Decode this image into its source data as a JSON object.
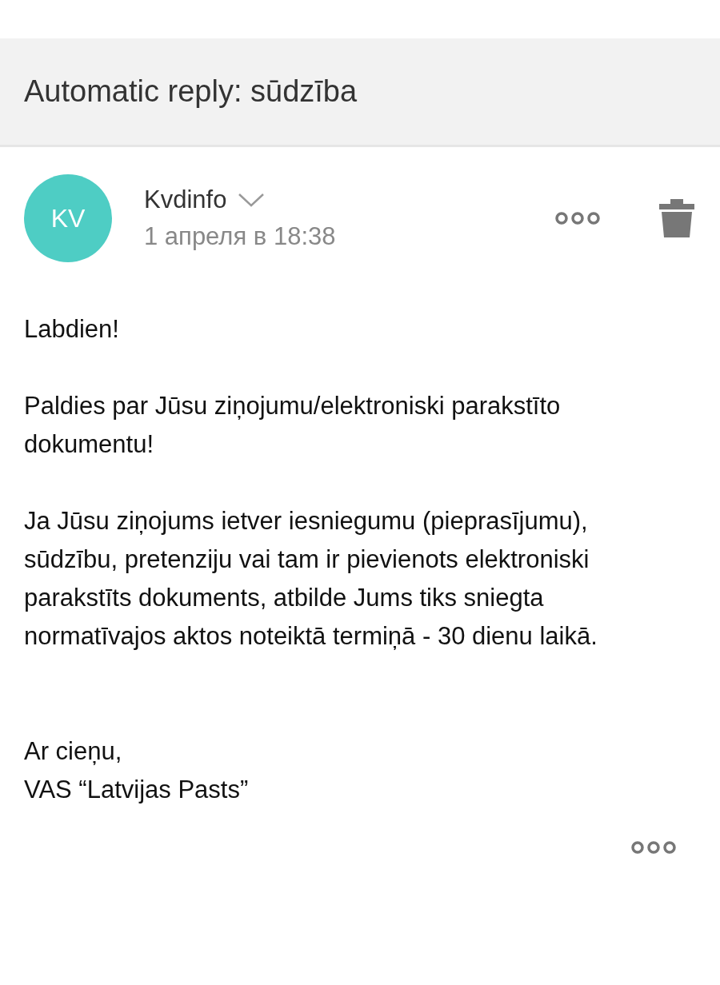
{
  "header": {
    "title": "Automatic reply: sūdzība"
  },
  "sender": {
    "initials": "KV",
    "color": "#4ecdc4",
    "name": "Kvdinfo",
    "date": "1 апреля в 18:38"
  },
  "body": {
    "paragraphs": [
      "Labdien!",
      "Paldies par Jūsu ziņojumu/elektroniski parakstīto dokumentu!",
      "Ja Jūsu ziņojums ietver iesniegumu (pieprasījumu), sūdzību, pretenziju vai tam ir pievienots elektroniski parakstīts dokuments, atbilde Jums tiks sniegta normatīvajos aktos noteiktā termiņā - 30 dienu laikā."
    ],
    "signature": [
      "Ar cieņu,",
      "VAS “Latvijas Pasts”"
    ]
  }
}
